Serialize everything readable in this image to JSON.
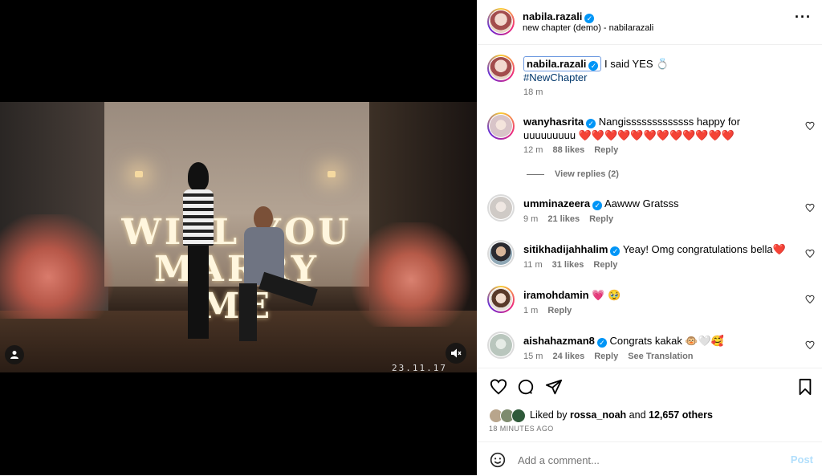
{
  "media": {
    "letters_line1": "WILL YOU",
    "letters_line2": "MARRY ME",
    "datestamp": "23.11.17"
  },
  "header": {
    "username": "nabila.razali",
    "subtitle": "new chapter (demo) - nabilarazali",
    "more_icon": "more-horizontal-icon"
  },
  "caption": {
    "username": "nabila.razali",
    "text": "I said YES 💍",
    "hashtag": "#NewChapter",
    "time": "18 m"
  },
  "comments": [
    {
      "username": "wanyhasrita",
      "text": "Nangisssssssssssss happy for uuuuuuuuu ❤️❤️❤️❤️❤️❤️❤️❤️❤️❤️❤️❤️",
      "time": "12 m",
      "likes": "88 likes",
      "reply": "Reply",
      "view_replies": "View replies (2)"
    },
    {
      "username": "umminazeera",
      "text": "Aawww Gratsss",
      "time": "9 m",
      "likes": "21 likes",
      "reply": "Reply"
    },
    {
      "username": "sitikhadijahhalim",
      "text": "Yeay! Omg congratulations bella❤️",
      "time": "11 m",
      "likes": "31 likes",
      "reply": "Reply"
    },
    {
      "username": "iramohdamin",
      "text": "💗 🥹",
      "time": "1 m",
      "reply": "Reply"
    },
    {
      "username": "aishahazman8",
      "text": "Congrats kakak 🐵🤍🥰",
      "time": "15 m",
      "likes": "24 likes",
      "reply": "Reply",
      "translation": "See Translation"
    }
  ],
  "likes": {
    "prefix": "Liked by ",
    "user": "rossa_noah",
    "and": " and ",
    "count": "12,657",
    "suffix": " others",
    "time": "18 MINUTES AGO"
  },
  "add_comment": {
    "placeholder": "Add a comment...",
    "post": "Post"
  },
  "colors": {
    "verified": "#0095f6",
    "hashtag": "#00376b",
    "post_disabled": "#b2dffc"
  }
}
